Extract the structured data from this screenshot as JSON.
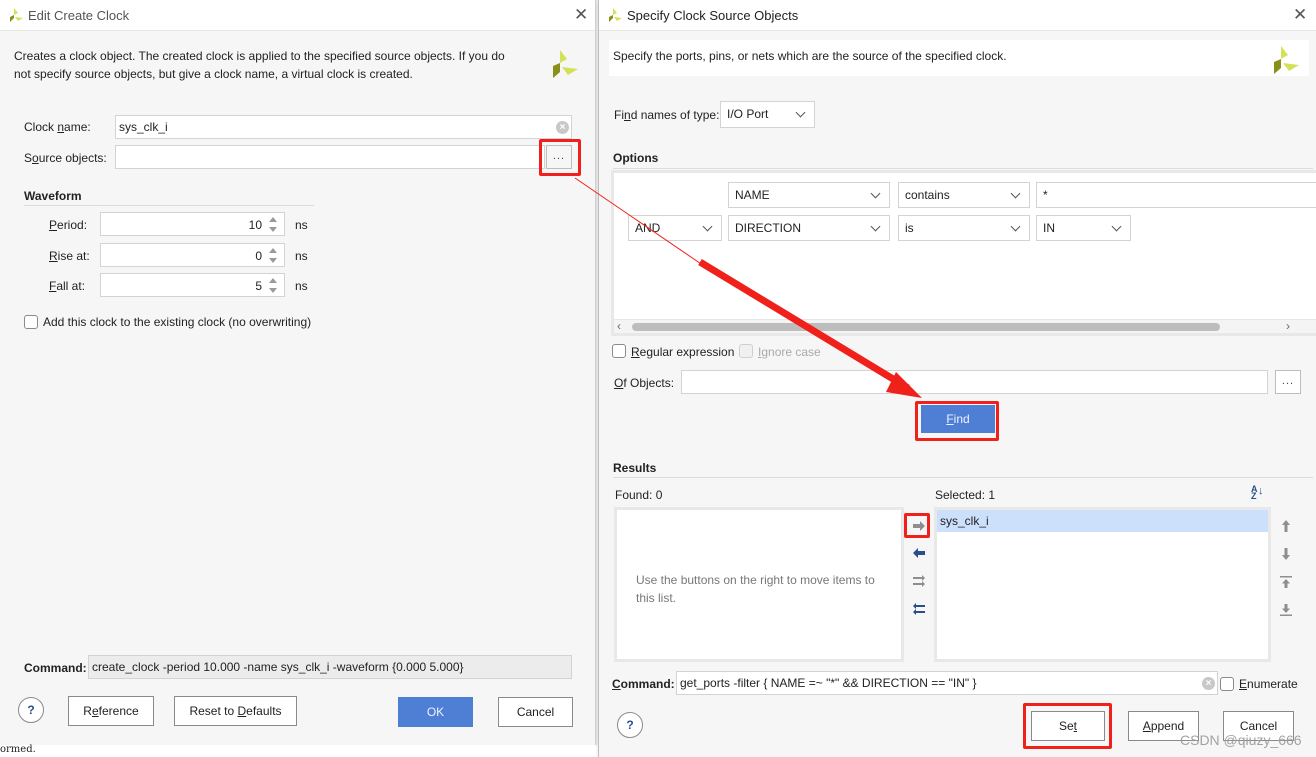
{
  "left_dialog": {
    "title": "Edit Create Clock",
    "description": "Creates a clock object. The created clock is applied to the specified source objects. If you do not specify source objects, but give a clock name, a virtual clock is created.",
    "clock_name_label": "Clock name:",
    "clock_name_value": "sys_clk_i",
    "source_objects_label": "Source objects:",
    "source_objects_value": "",
    "browse_label": "...",
    "waveform_heading": "Waveform",
    "period_label": "Period:",
    "period_value": "10",
    "rise_label": "Rise at:",
    "rise_value": "0",
    "fall_label": "Fall at:",
    "fall_value": "5",
    "unit": "ns",
    "add_clock_label": "Add this clock to the existing clock (no overwriting)",
    "add_clock_checked": false,
    "command_label": "Command:",
    "command_value": "create_clock -period 10.000 -name sys_clk_i -waveform {0.000 5.000}",
    "help_label": "?",
    "reference_label": "Reference",
    "reset_label": "Reset to Defaults",
    "ok_label": "OK",
    "cancel_label": "Cancel",
    "console_fragment": "ormed."
  },
  "right_dialog": {
    "title": "Specify Clock Source Objects",
    "description": "Specify the ports, pins, or nets which are the source of the specified clock.",
    "find_type_label": "Find names of type:",
    "find_type_value": "I/O Port",
    "options_heading": "Options",
    "filters": [
      {
        "logic": "",
        "property": "NAME",
        "operator": "contains",
        "value": "*"
      },
      {
        "logic": "AND",
        "property": "DIRECTION",
        "operator": "is",
        "value": "IN"
      }
    ],
    "regex_label": "Regular expression",
    "regex_checked": false,
    "ignore_case_label": "Ignore case",
    "ignore_case_disabled": true,
    "of_objects_label": "Of Objects:",
    "of_objects_value": "",
    "browse_label": "...",
    "find_label": "Find",
    "results_heading": "Results",
    "found_label": "Found: 0",
    "selected_label": "Selected: 1",
    "found_placeholder": "Use the buttons on the right to move items to this list.",
    "selected_items": [
      "sys_clk_i"
    ],
    "command_label": "Command:",
    "command_value": "get_ports -filter { NAME =~  \"*\" && DIRECTION == \"IN\" }",
    "enumerate_label": "Enumerate",
    "enumerate_checked": false,
    "help_label": "?",
    "set_label": "Set",
    "append_label": "Append",
    "cancel_label": "Cancel"
  },
  "colors": {
    "accent_blue": "#4f7fd5",
    "annotation_red": "#f0201a",
    "selection_blue": "#cde0fb",
    "logo_dark": "#8a8f1a",
    "logo_light": "#d4e157"
  },
  "watermark": "CSDN @qiuzy_666"
}
